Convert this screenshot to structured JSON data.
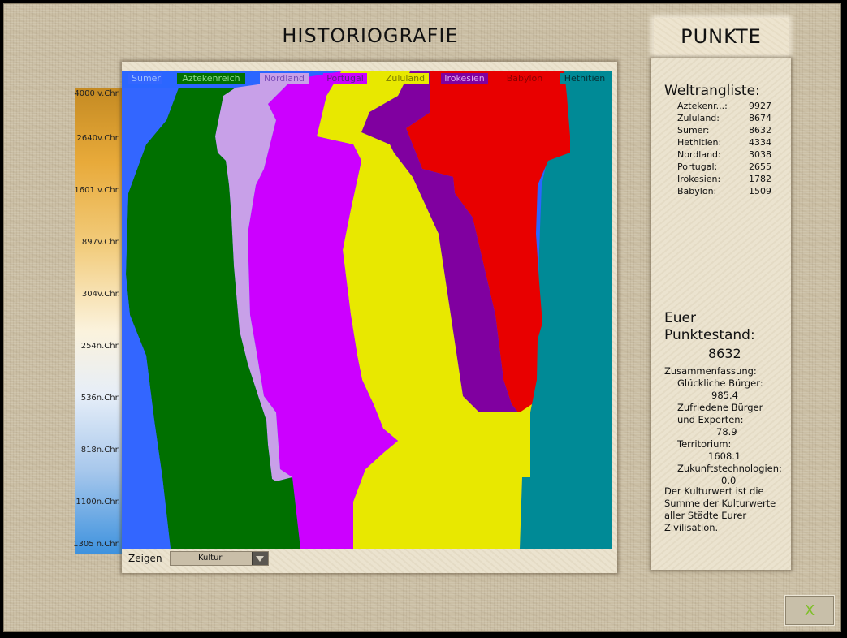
{
  "header": {
    "title": "HISTORIOGRAFIE",
    "punkte_tab": "PUNKTE"
  },
  "timeline": {
    "labels": [
      "4000 v.Chr.",
      "2640v.Chr.",
      "1601 v.Chr.",
      "897v.Chr.",
      "304v.Chr.",
      "254n.Chr.",
      "536n.Chr.",
      "818n.Chr.",
      "1100n.Chr.",
      "1305 n.Chr."
    ]
  },
  "legend": [
    {
      "name": "Sumer",
      "color": "#3366ff",
      "text_color": "#9fc0ff"
    },
    {
      "name": "Aztekenreich",
      "color": "#007000",
      "text_color": "#8fdc8f"
    },
    {
      "name": "Nordland",
      "color": "#c8a0e8",
      "text_color": "#7a4cb8"
    },
    {
      "name": "Portugal",
      "color": "#cc00ff",
      "text_color": "#5a2080"
    },
    {
      "name": "Zululand",
      "color": "#e8e800",
      "text_color": "#7a7a00"
    },
    {
      "name": "Irokesien",
      "color": "#8000a0",
      "text_color": "#e0a8f0"
    },
    {
      "name": "Babylon",
      "color": "#e80000",
      "text_color": "#8a0000"
    },
    {
      "name": "Hethitien",
      "color": "#008a96",
      "text_color": "#062f34"
    }
  ],
  "controls": {
    "zeigen_label": "Zeigen",
    "select_value": "Kultur"
  },
  "ranking": {
    "title": "Weltrangliste:",
    "entries": [
      {
        "name": "Aztekenr...:",
        "score": "9927"
      },
      {
        "name": "Zululand:",
        "score": "8674"
      },
      {
        "name": "Sumer:",
        "score": "8632"
      },
      {
        "name": "Hethitien:",
        "score": "4334"
      },
      {
        "name": "Nordland:",
        "score": "3038"
      },
      {
        "name": "Portugal:",
        "score": "2655"
      },
      {
        "name": "Irokesien:",
        "score": "1782"
      },
      {
        "name": "Babylon:",
        "score": "1509"
      }
    ]
  },
  "score": {
    "title": "Euer Punktestand:",
    "value": "8632",
    "summary_title": "Zusammenfassung:",
    "happy_label": "Glückliche Bürger:",
    "happy_value": "985.4",
    "content_label_1": "Zufriedene Bürger",
    "content_label_2": "und Experten:",
    "content_value": "78.9",
    "territory_label": "Territorium:",
    "territory_value": "1608.1",
    "future_label": "Zukunftstechnologien:",
    "future_value": "0.0",
    "note_1": "Der Kulturwert ist die",
    "note_2": "Summe der Kulturwerte",
    "note_3": "aller Städte Eurer",
    "note_4": "Zivilisation."
  },
  "close_button": {
    "label": "X"
  }
}
